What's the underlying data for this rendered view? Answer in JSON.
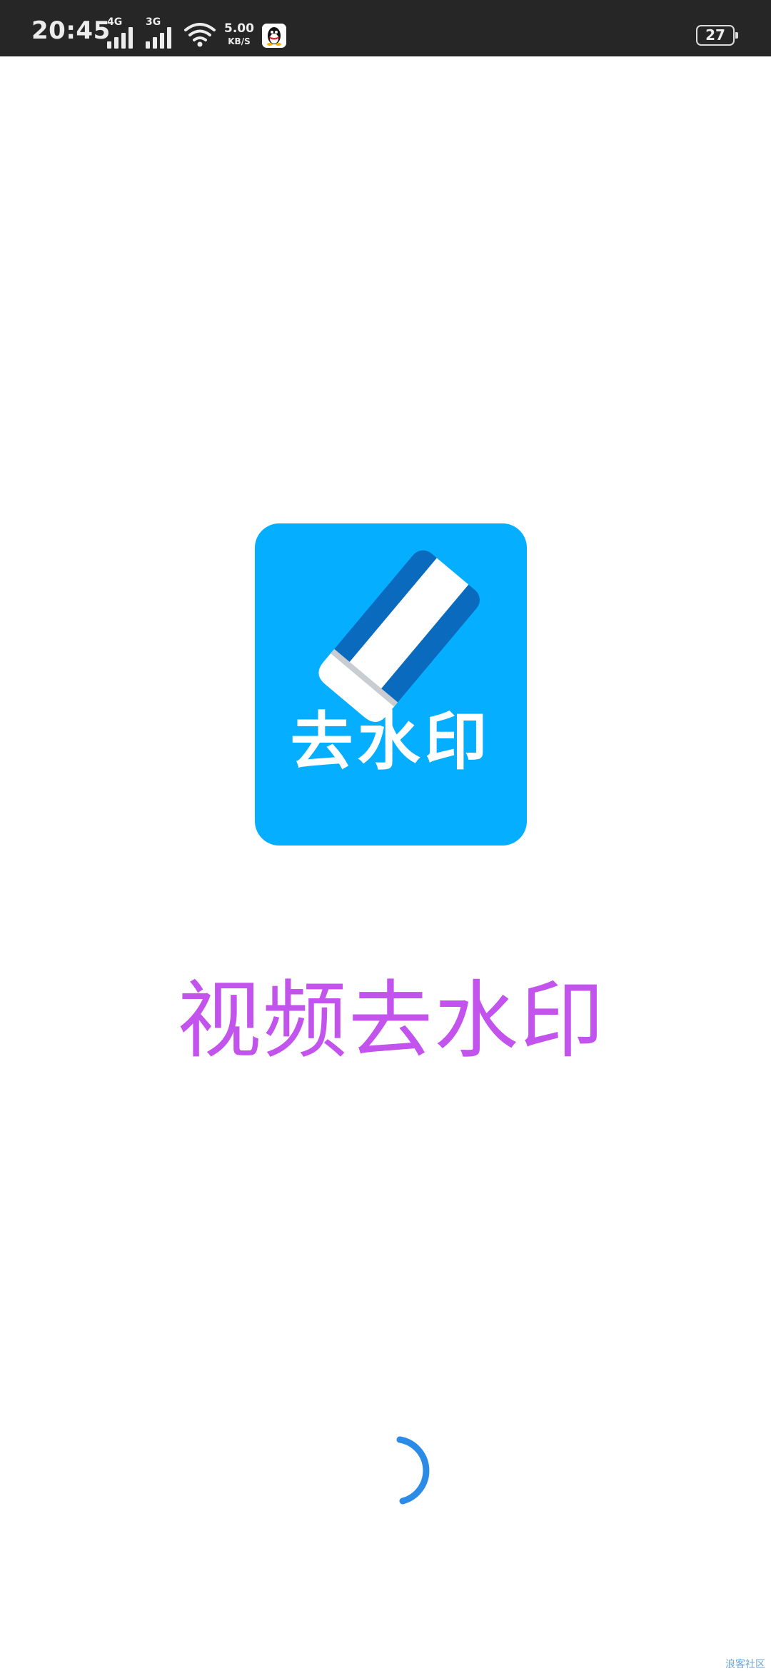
{
  "status_bar": {
    "time": "20:45",
    "signal1_label": "4G",
    "signal2_label": "3G",
    "net_speed_value": "5.00",
    "net_speed_unit": "KB/S",
    "battery_level": "27",
    "icons": [
      "signal-4g-icon",
      "signal-3g-icon",
      "wifi-icon",
      "qq-notification-icon",
      "battery-icon"
    ]
  },
  "splash": {
    "logo_text": "去水印",
    "app_name": "视频去水印",
    "colors": {
      "logo_background": "#06AEFF",
      "eraser_dark": "#0A6BBE",
      "app_name": "#C253EC",
      "spinner": "#2C8BE6"
    }
  },
  "watermark": "浪客社区"
}
